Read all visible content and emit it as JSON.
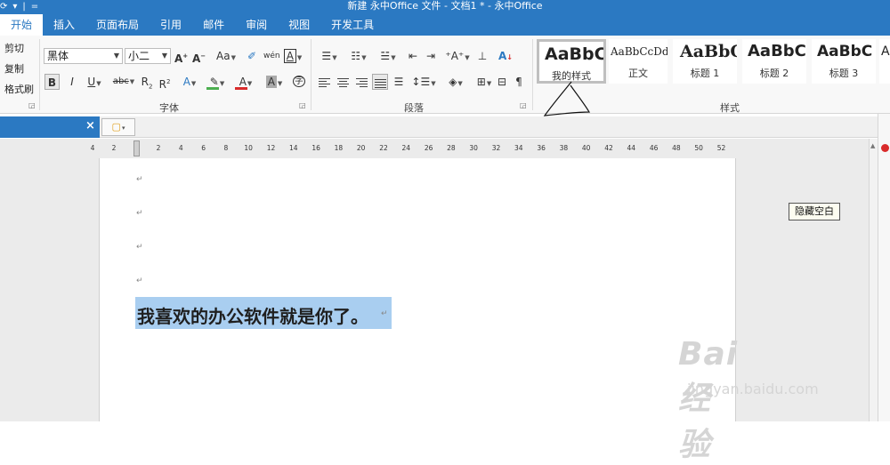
{
  "window": {
    "title": "新建 永中Office 文件 - 文档1 * - 永中Office",
    "qat": [
      "⟳",
      "▾",
      "|",
      "="
    ]
  },
  "tabs": [
    "开始",
    "插入",
    "页面布局",
    "引用",
    "邮件",
    "审阅",
    "视图",
    "开发工具"
  ],
  "ribbon": {
    "clipboard": {
      "cut": "剪切",
      "copy": "复制",
      "painter": "格式刷"
    },
    "font": {
      "family": "黑体",
      "size": "小二",
      "grow": "A",
      "shrink": "A",
      "change_case": "Aa",
      "clear": "✐",
      "phonetic": "wén",
      "border_char": "A",
      "bold": "B",
      "italic": "I",
      "underline": "U",
      "strike": "abc",
      "sub": "R",
      "sup": "R",
      "effects": "A",
      "highlight": "✎",
      "color": "A",
      "shade": "A",
      "enclose": "字",
      "highlight_color": "#4caf50",
      "font_color": "#d92b2b"
    },
    "paragraph": {
      "sort": "A",
      "mark": "¶"
    },
    "group_labels": {
      "font": "字体",
      "paragraph": "段落",
      "styles": "样式"
    },
    "styles": [
      {
        "preview": "AaBbCc",
        "name": "我的样式",
        "selected": true
      },
      {
        "preview": "AaBbCcDd",
        "name": "正文",
        "selected": false
      },
      {
        "preview": "AaBbC",
        "name": "标题 1",
        "selected": false
      },
      {
        "preview": "AaBbC",
        "name": "标题 2",
        "selected": false
      },
      {
        "preview": "AaBbC",
        "name": "标题 3",
        "selected": false
      },
      {
        "preview": "A",
        "name": "",
        "selected": false
      }
    ]
  },
  "doc_tabs": {
    "close": "×",
    "new_doc": "▾"
  },
  "ruler": {
    "labels": [
      "4",
      "2",
      "2",
      "4",
      "6",
      "8",
      "10",
      "12",
      "14",
      "16",
      "18",
      "20",
      "22",
      "24",
      "26",
      "28",
      "30",
      "32",
      "34",
      "36",
      "38",
      "40",
      "42",
      "44",
      "46",
      "48",
      "50",
      "52"
    ]
  },
  "document": {
    "para_marks": [
      "↵",
      "↵",
      "↵",
      "↵"
    ],
    "body_text": "我喜欢的办公软件就是你了。",
    "end_mark": "↵",
    "selection_color": "#a9cef0"
  },
  "tooltip": "隐藏空白",
  "watermark": {
    "logo": "Bai经验",
    "url": "jingyan.baidu.com"
  }
}
